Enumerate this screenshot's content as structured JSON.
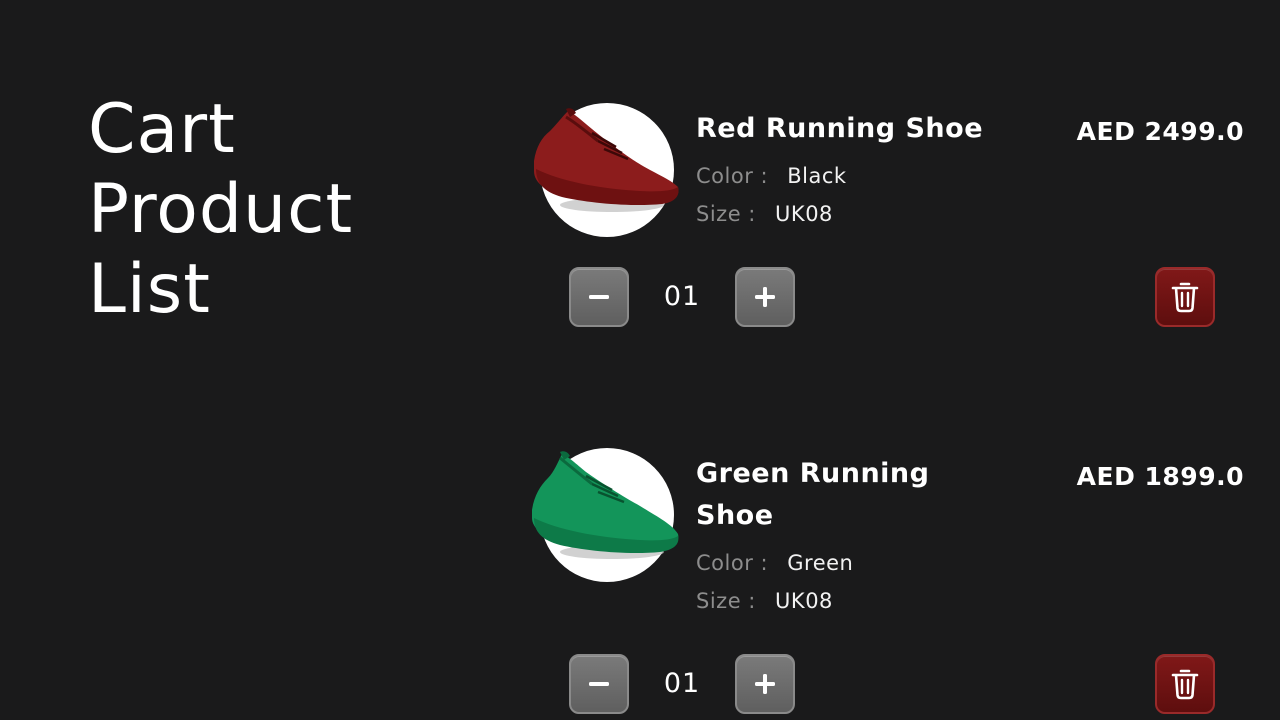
{
  "page": {
    "title_lines": [
      "Cart",
      "Product",
      "List"
    ]
  },
  "theme": {
    "background": "#1a1a1b",
    "text": "#ffffff",
    "muted_label": "#8d8d8d",
    "qty_button": "#6b6b6b",
    "delete_button": "#6e1414"
  },
  "cart": {
    "items": [
      {
        "name": "Red Running Shoe",
        "price": "AED 2499.0",
        "color_label": "Color :",
        "color_value": "Black",
        "size_label": "Size :",
        "size_value": "UK08",
        "quantity": "01",
        "image_icon": "red-shoe",
        "shoe_color": "#8c1c1c"
      },
      {
        "name": "Green Running Shoe",
        "price": "AED 1899.0",
        "color_label": "Color :",
        "color_value": "Green",
        "size_label": "Size :",
        "size_value": "UK08",
        "quantity": "01",
        "image_icon": "green-shoe",
        "shoe_color": "#13955a"
      }
    ],
    "icons": {
      "decrease": "minus-icon",
      "increase": "plus-icon",
      "remove": "trash-icon"
    }
  }
}
